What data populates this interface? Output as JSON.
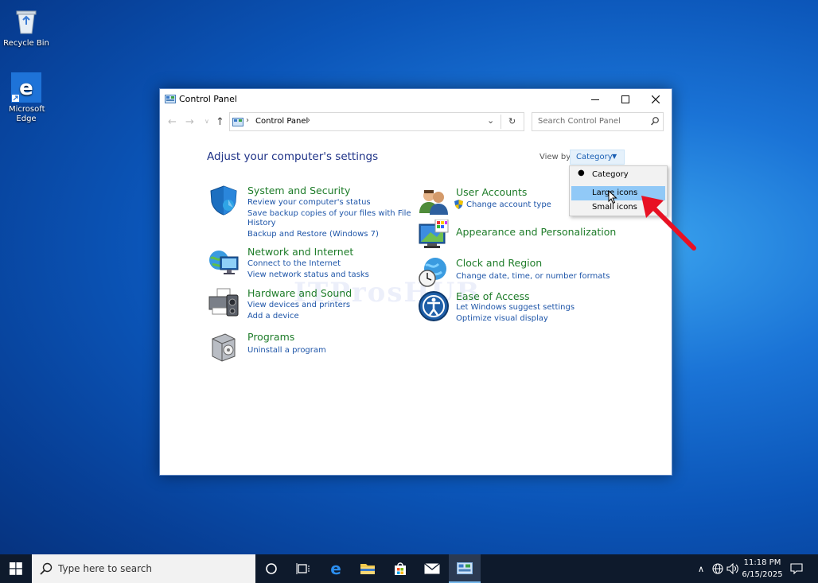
{
  "desktop": {
    "icons": [
      {
        "label": "Recycle Bin",
        "icon": "recycle-bin-icon"
      },
      {
        "label": "Microsoft Edge",
        "icon": "edge-icon"
      }
    ]
  },
  "window": {
    "title": "Control Panel",
    "address_crumb": "Control Panel",
    "search_placeholder": "Search Control Panel",
    "heading": "Adjust your computer's settings",
    "view_by_label": "View by:",
    "view_by_value": "Category"
  },
  "categories": {
    "system": {
      "title": "System and Security",
      "links": [
        "Review your computer's status",
        "Save backup copies of your files with File",
        "History",
        "Backup and Restore (Windows 7)"
      ]
    },
    "network": {
      "title": "Network and Internet",
      "links": [
        "Connect to the Internet",
        "View network status and tasks"
      ]
    },
    "hardware": {
      "title": "Hardware and Sound",
      "links": [
        "View devices and printers",
        "Add a device"
      ]
    },
    "programs": {
      "title": "Programs",
      "links": [
        "Uninstall a program"
      ]
    },
    "users": {
      "title": "User Accounts",
      "links": [
        "Change account type"
      ]
    },
    "appearance": {
      "title": "Appearance and Personalization",
      "links": []
    },
    "clock": {
      "title": "Clock and Region",
      "links": [
        "Change date, time, or number formats"
      ]
    },
    "ease": {
      "title": "Ease of Access",
      "links": [
        "Let Windows suggest settings",
        "Optimize visual display"
      ]
    }
  },
  "view_menu": {
    "items": [
      "Category",
      "Large icons",
      "Small icons"
    ],
    "selected": "Category",
    "highlighted": "Large icons"
  },
  "watermark": "ITProsHUB",
  "taskbar": {
    "search_placeholder": "Type here to search",
    "time": "11:18 PM",
    "date": "6/15/2025"
  },
  "colors": {
    "accent": "#1a5fb4",
    "category_title": "#1e7c29",
    "link": "#1e55a8",
    "arrow": "#e81123"
  }
}
